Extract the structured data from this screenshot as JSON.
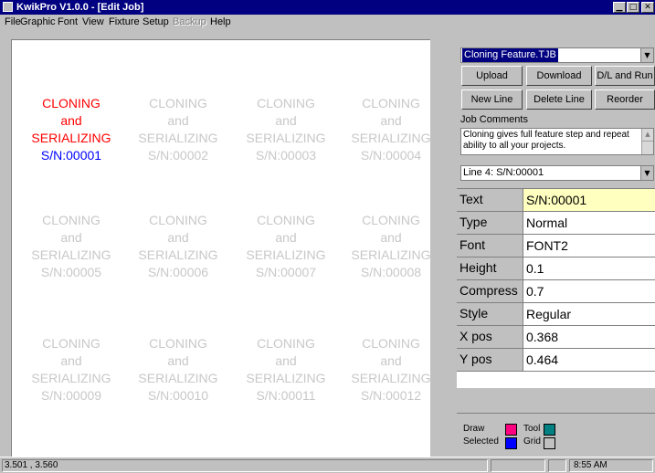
{
  "window": {
    "title": "KwikPro  V1.0.0 - [Edit Job]",
    "controls": {
      "minimize": "▁",
      "maximize": "□",
      "close": "✕"
    }
  },
  "menu": [
    {
      "label": "File",
      "disabled": false
    },
    {
      "label": "Graphic",
      "disabled": false
    },
    {
      "label": "Font",
      "disabled": false
    },
    {
      "label": "View",
      "disabled": false
    },
    {
      "label": "Fixture",
      "disabled": false
    },
    {
      "label": "Setup",
      "disabled": false
    },
    {
      "label": "Backup",
      "disabled": true
    },
    {
      "label": "Help",
      "disabled": false
    }
  ],
  "canvas": {
    "cells": [
      {
        "l1": "CLONING",
        "l2": "and",
        "l3": "SERIALIZING",
        "l4": "S/N:00001",
        "active": true
      },
      {
        "l1": "CLONING",
        "l2": "and",
        "l3": "SERIALIZING",
        "l4": "S/N:00002",
        "active": false
      },
      {
        "l1": "CLONING",
        "l2": "and",
        "l3": "SERIALIZING",
        "l4": "S/N:00003",
        "active": false
      },
      {
        "l1": "CLONING",
        "l2": "and",
        "l3": "SERIALIZING",
        "l4": "S/N:00004",
        "active": false
      },
      {
        "l1": "CLONING",
        "l2": "and",
        "l3": "SERIALIZING",
        "l4": "S/N:00005",
        "active": false
      },
      {
        "l1": "CLONING",
        "l2": "and",
        "l3": "SERIALIZING",
        "l4": "S/N:00006",
        "active": false
      },
      {
        "l1": "CLONING",
        "l2": "and",
        "l3": "SERIALIZING",
        "l4": "S/N:00007",
        "active": false
      },
      {
        "l1": "CLONING",
        "l2": "and",
        "l3": "SERIALIZING",
        "l4": "S/N:00008",
        "active": false
      },
      {
        "l1": "CLONING",
        "l2": "and",
        "l3": "SERIALIZING",
        "l4": "S/N:00009",
        "active": false
      },
      {
        "l1": "CLONING",
        "l2": "and",
        "l3": "SERIALIZING",
        "l4": "S/N:00010",
        "active": false
      },
      {
        "l1": "CLONING",
        "l2": "and",
        "l3": "SERIALIZING",
        "l4": "S/N:00011",
        "active": false
      },
      {
        "l1": "CLONING",
        "l2": "and",
        "l3": "SERIALIZING",
        "l4": "S/N:00012",
        "active": false
      }
    ]
  },
  "panel": {
    "job_file": "Cloning Feature.TJB",
    "buttons": {
      "upload": "Upload",
      "download": "Download",
      "dl_run": "D/L and Run",
      "new_line": "New Line",
      "delete_line": "Delete Line",
      "reorder": "Reorder"
    },
    "job_comments_label": "Job Comments",
    "job_comments": "Cloning gives full feature step and repeat ability to all your projects.",
    "line_select": "Line 4: S/N:00001",
    "properties": [
      {
        "name": "Text",
        "value": "S/N:00001"
      },
      {
        "name": "Type",
        "value": "Normal"
      },
      {
        "name": "Font",
        "value": "FONT2"
      },
      {
        "name": "Height",
        "value": "0.1"
      },
      {
        "name": "Compress",
        "value": "0.7"
      },
      {
        "name": "Style",
        "value": "Regular"
      },
      {
        "name": "X pos",
        "value": "0.368"
      },
      {
        "name": "Y pos",
        "value": "0.464"
      }
    ]
  },
  "legend": {
    "draw": "Draw",
    "selected": "Selected",
    "tool": "Tool",
    "grid": "Grid",
    "colors": {
      "draw": "#ff0080",
      "selected": "#0000ff",
      "tool": "#008080",
      "grid": "#c0c0c0"
    }
  },
  "status": {
    "coords": "3.501 , 3.560",
    "time": "8:55 AM"
  },
  "colors": {
    "title_bar": "#000080",
    "active_text": "#ff0000",
    "active_serial": "#0000ff",
    "clone_text": "#c8c8c8",
    "highlight_field": "#ffffc0"
  }
}
